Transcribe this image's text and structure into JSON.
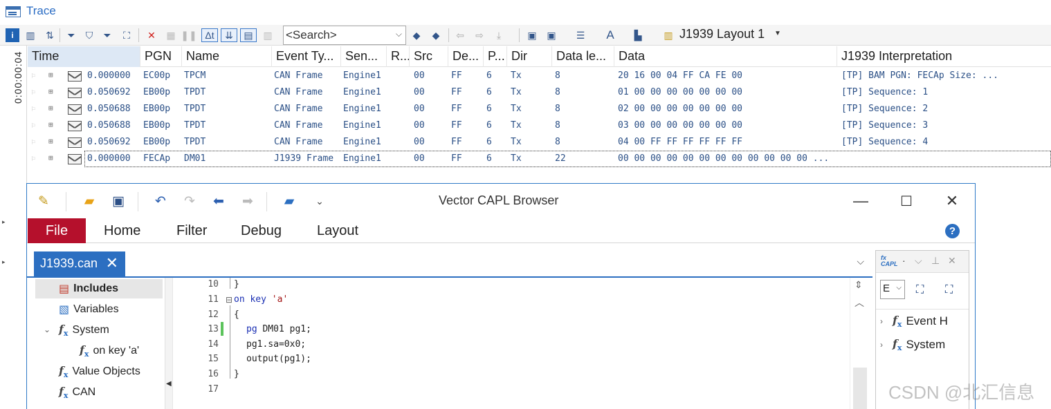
{
  "trace": {
    "title": "Trace",
    "search_placeholder": "<Search>",
    "layout_label": "J1939 Layout 1",
    "vertical_time": "0:00:00:04",
    "columns": [
      "Time",
      "PGN",
      "Name",
      "Event Ty...",
      "Sen...",
      "R...",
      "Src",
      "De...",
      "P...",
      "Dir",
      "Data le...",
      "Data",
      "J1939 Interpretation"
    ],
    "rows": [
      {
        "time": "0.000000",
        "pgn": "EC00p",
        "name": "TPCM",
        "event": "CAN Frame",
        "sender": "Engine1",
        "r": "",
        "src": "00",
        "dest": "FF",
        "p": "6",
        "dir": "Tx",
        "dlen": "8",
        "data": "20 16 00 04 FF CA FE 00",
        "interp": "[TP] BAM      PGN: FECAp   Size:  ..."
      },
      {
        "time": "0.050692",
        "pgn": "EB00p",
        "name": "TPDT",
        "event": "CAN Frame",
        "sender": "Engine1",
        "r": "",
        "src": "00",
        "dest": "FF",
        "p": "6",
        "dir": "Tx",
        "dlen": "8",
        "data": "01 00 00 00 00 00 00 00",
        "interp": "[TP] Sequence:  1"
      },
      {
        "time": "0.050688",
        "pgn": "EB00p",
        "name": "TPDT",
        "event": "CAN Frame",
        "sender": "Engine1",
        "r": "",
        "src": "00",
        "dest": "FF",
        "p": "6",
        "dir": "Tx",
        "dlen": "8",
        "data": "02 00 00 00 00 00 00 00",
        "interp": "[TP] Sequence:  2"
      },
      {
        "time": "0.050688",
        "pgn": "EB00p",
        "name": "TPDT",
        "event": "CAN Frame",
        "sender": "Engine1",
        "r": "",
        "src": "00",
        "dest": "FF",
        "p": "6",
        "dir": "Tx",
        "dlen": "8",
        "data": "03 00 00 00 00 00 00 00",
        "interp": "[TP] Sequence:  3"
      },
      {
        "time": "0.050692",
        "pgn": "EB00p",
        "name": "TPDT",
        "event": "CAN Frame",
        "sender": "Engine1",
        "r": "",
        "src": "00",
        "dest": "FF",
        "p": "6",
        "dir": "Tx",
        "dlen": "8",
        "data": "04 00 FF FF FF FF FF FF",
        "interp": "[TP] Sequence:  4"
      },
      {
        "time": "0.000000",
        "pgn": "FECAp",
        "name": "DM01",
        "event": "J1939 Frame",
        "sender": "Engine1",
        "r": "",
        "src": "00",
        "dest": "FF",
        "p": "6",
        "dir": "Tx",
        "dlen": "22",
        "data": "00 00 00 00 00 00 00 00 00 00 00 00  ...",
        "interp": ""
      }
    ]
  },
  "capl": {
    "title": "Vector CAPL Browser",
    "ribbon_tabs": [
      "File",
      "Home",
      "Filter",
      "Debug",
      "Layout"
    ],
    "doc_tab": "J1939.can",
    "tree": {
      "includes": "Includes",
      "variables": "Variables",
      "system": "System",
      "on_key": "on key 'a'",
      "value_objects": "Value Objects",
      "can": "CAN"
    },
    "code": {
      "line_numbers": [
        "10",
        "11",
        "12",
        "13",
        "14",
        "15",
        "16",
        "17"
      ],
      "l10": "}",
      "l11_kw": "on key",
      "l11_str": "'a'",
      "l12": "{",
      "l13_kw": "pg",
      "l13_rest": " DM01 pg1;",
      "l14": "pg1.sa=0x0;",
      "l15": "output(pg1);",
      "l16": "}"
    },
    "side_panel": {
      "dropdown_value": "E",
      "items": [
        "Event H",
        "System"
      ]
    }
  },
  "watermark": "CSDN @北汇信息",
  "colors": {
    "accent": "#2c6fc1",
    "file_tab": "#b5102c",
    "trace_text": "#2a4f86",
    "keyword": "#1a2fb3",
    "string": "#a31515",
    "change_bar": "#5cc35c"
  }
}
